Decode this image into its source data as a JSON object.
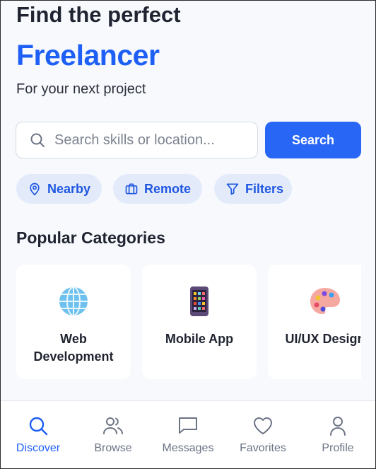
{
  "hero": {
    "title": "Find the perfect",
    "accent": "Freelancer",
    "subtitle": "For your next project"
  },
  "search": {
    "placeholder": "Search skills or location...",
    "button_label": "Search"
  },
  "filters": [
    {
      "label": "Nearby",
      "icon": "location-pin-icon"
    },
    {
      "label": "Remote",
      "icon": "briefcase-icon"
    },
    {
      "label": "Filters",
      "icon": "filter-icon"
    }
  ],
  "categories": {
    "title": "Popular Categories",
    "items": [
      {
        "label": "Web Development",
        "icon": "globe-icon"
      },
      {
        "label": "Mobile App",
        "icon": "mobile-phone-icon"
      },
      {
        "label": "UI/UX Design",
        "icon": "palette-icon"
      }
    ]
  },
  "tabs": [
    {
      "label": "Discover",
      "icon": "search-icon",
      "active": true
    },
    {
      "label": "Browse",
      "icon": "users-icon",
      "active": false
    },
    {
      "label": "Messages",
      "icon": "chat-icon",
      "active": false
    },
    {
      "label": "Favorites",
      "icon": "heart-icon",
      "active": false
    },
    {
      "label": "Profile",
      "icon": "person-icon",
      "active": false
    }
  ],
  "colors": {
    "accent": "#1e5ff5",
    "button": "#2866f6",
    "chip_bg": "#e3ebfb",
    "background": "#f7f9fd",
    "inactive_tab": "#6b7384"
  }
}
